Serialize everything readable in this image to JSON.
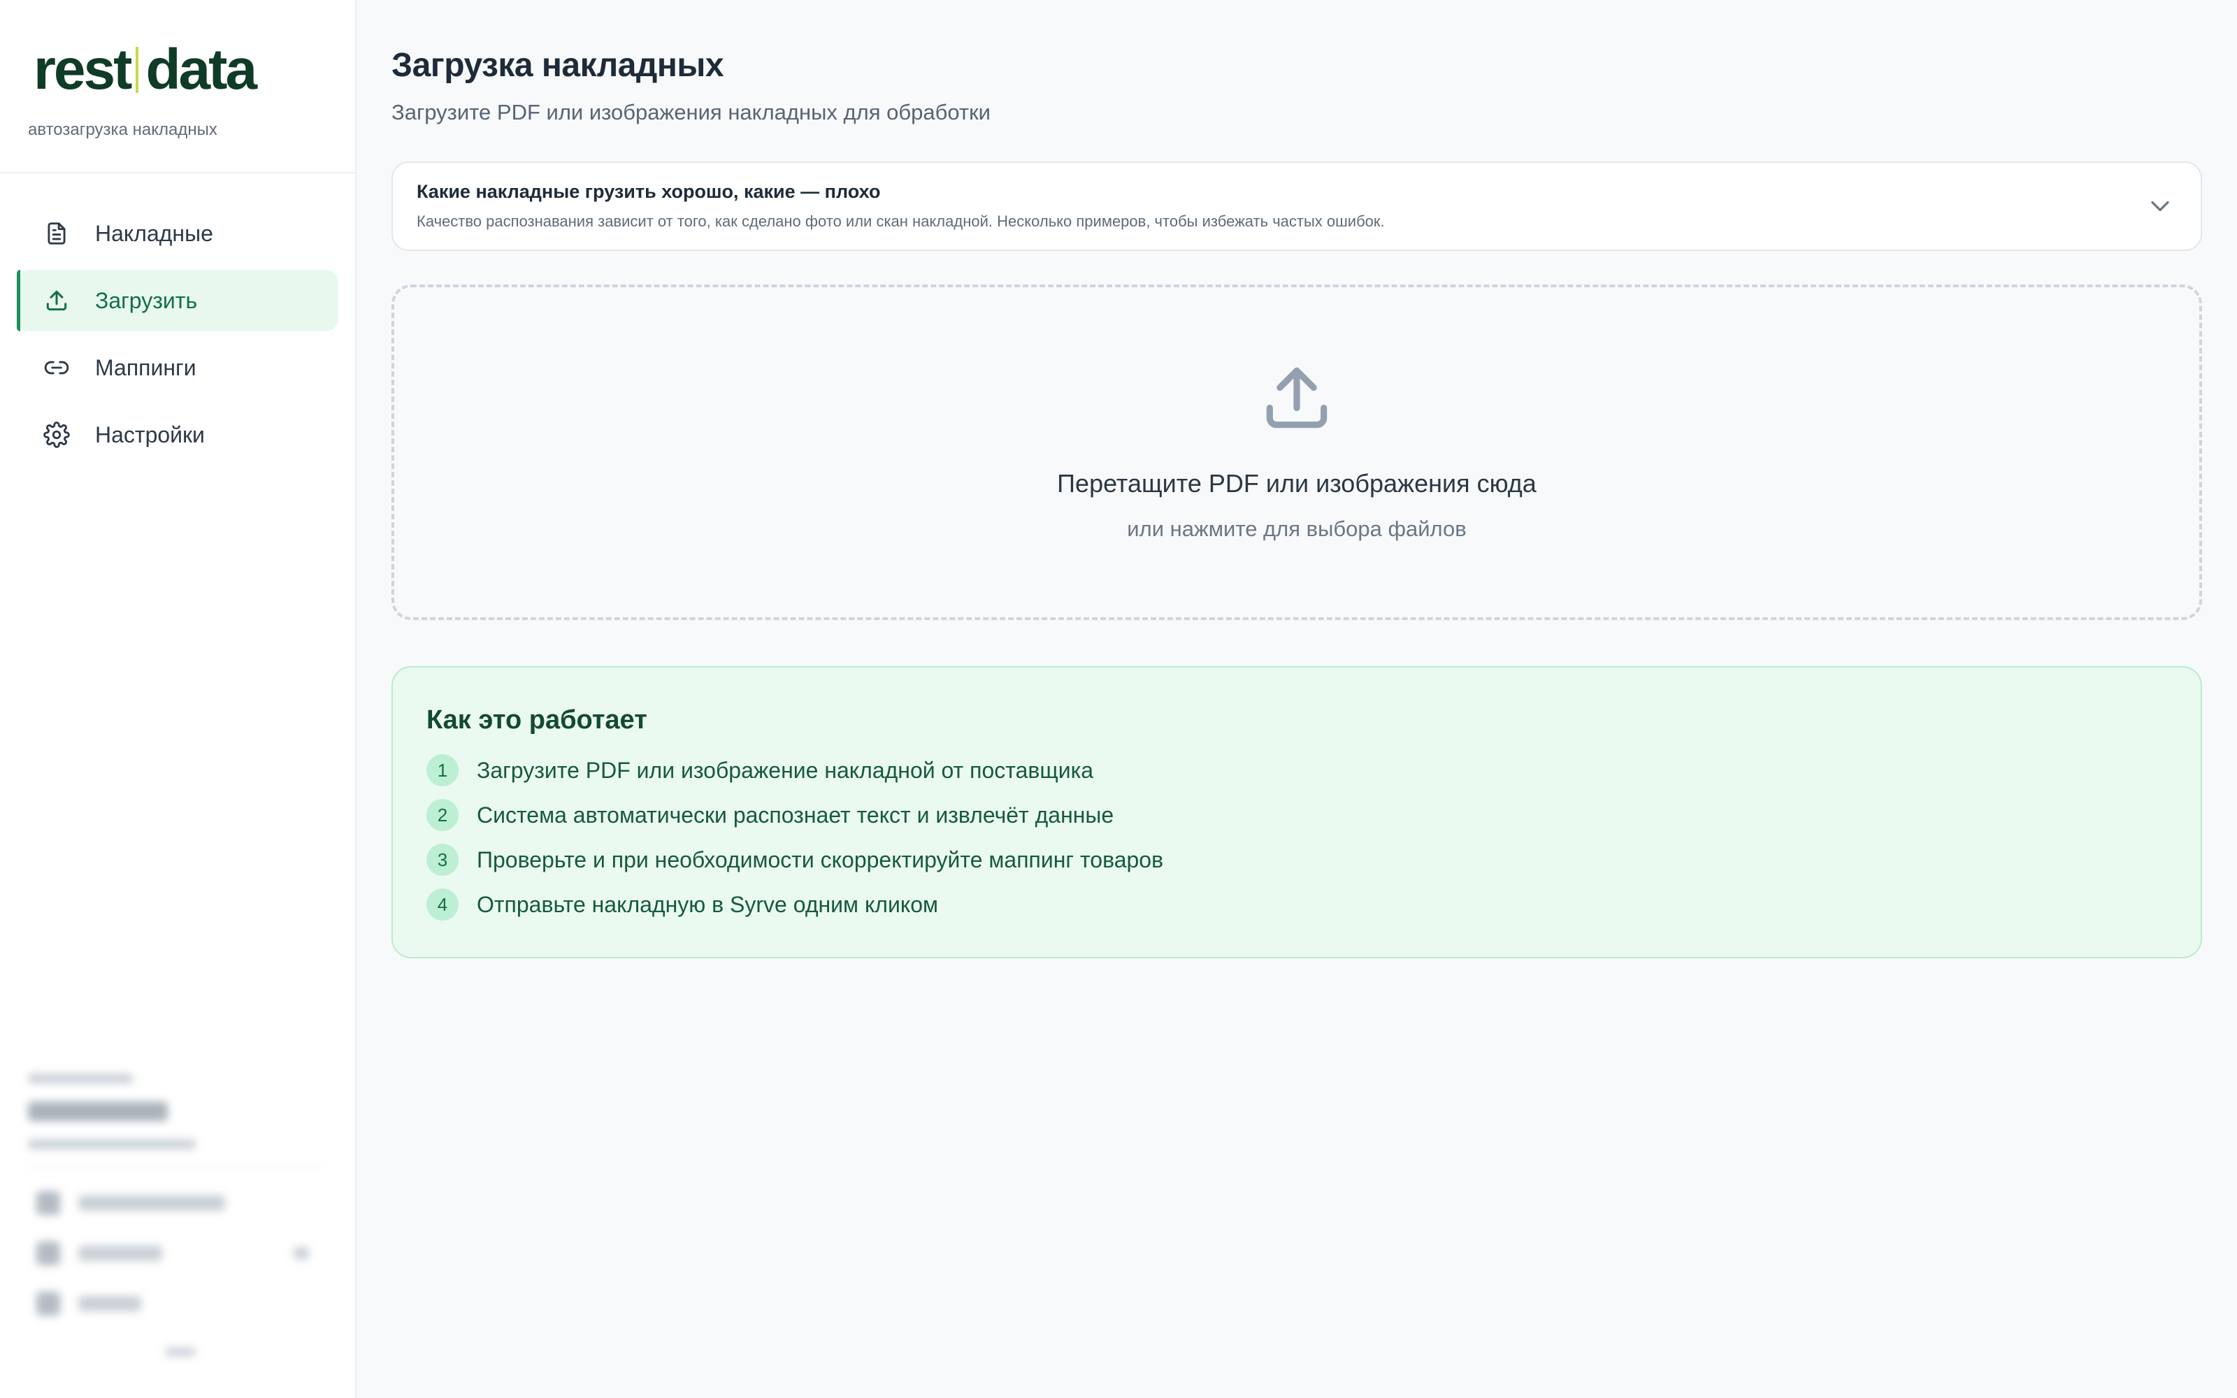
{
  "app": {
    "logo_left": "rest",
    "logo_right": "data",
    "subtitle": "автозагрузка накладных",
    "accent_color": "#1d8f5c"
  },
  "sidebar": {
    "items": [
      {
        "label": "Накладные",
        "icon": "document-icon",
        "active": false
      },
      {
        "label": "Загрузить",
        "icon": "upload-icon",
        "active": true
      },
      {
        "label": "Маппинги",
        "icon": "link-icon",
        "active": false
      },
      {
        "label": "Настройки",
        "icon": "gear-icon",
        "active": false
      }
    ]
  },
  "main": {
    "title": "Загрузка накладных",
    "subtitle": "Загрузите PDF или изображения накладных для обработки",
    "tips": {
      "title": "Какие накладные грузить хорошо, какие — плохо",
      "description": "Качество распознавания зависит от того, как сделано фото или скан накладной. Несколько примеров, чтобы избежать частых ошибок.",
      "icon": "chevron-down-icon"
    },
    "dropzone": {
      "icon": "upload-icon",
      "title": "Перетащите PDF или изображения сюда",
      "subtitle": "или нажмите для выбора файлов"
    },
    "how_it_works": {
      "title": "Как это работает",
      "steps": [
        {
          "num": "1",
          "text": "Загрузите PDF или изображение накладной от поставщика"
        },
        {
          "num": "2",
          "text": "Система автоматически распознает текст и извлечёт данные"
        },
        {
          "num": "3",
          "text": "Проверьте и при необходимости скорректируйте маппинг товаров"
        },
        {
          "num": "4",
          "text": "Отправьте накладную в Syrve одним кликом"
        }
      ]
    }
  }
}
